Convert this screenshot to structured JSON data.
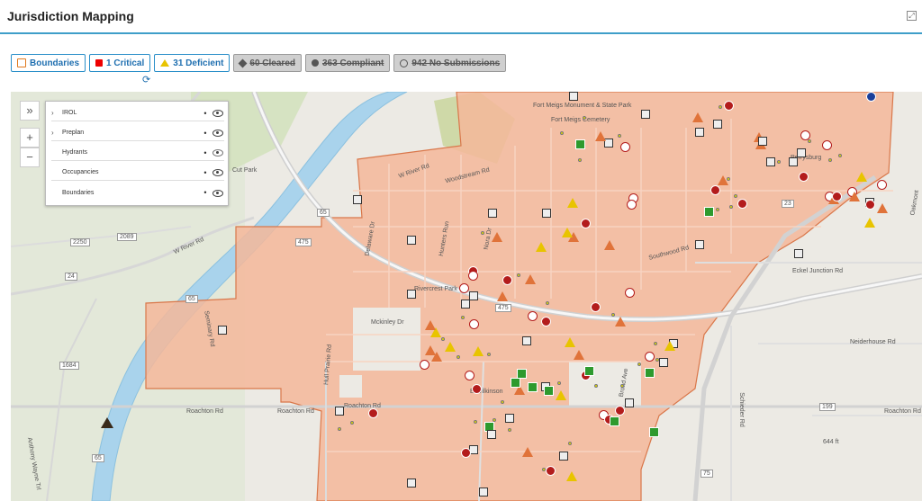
{
  "header": {
    "title": "Jurisdiction Mapping"
  },
  "filters": [
    {
      "label": "Boundaries",
      "icon": "boundary-icon",
      "active": true
    },
    {
      "label": "1 Critical",
      "icon": "critical-square-icon",
      "active": true
    },
    {
      "label": "31 Deficient",
      "icon": "deficient-triangle-icon",
      "active": true
    },
    {
      "label": "60 Cleared",
      "icon": "cleared-diamond-icon",
      "active": false
    },
    {
      "label": "363 Compliant",
      "icon": "compliant-circle-icon",
      "active": false
    },
    {
      "label": "942 No Submissions",
      "icon": "no-submissions-icon",
      "active": false
    }
  ],
  "refresh": {
    "icon": "refresh-icon",
    "glyph": "⟳"
  },
  "map_controls": {
    "collapse": "»",
    "zoom_in": "+",
    "zoom_out": "−"
  },
  "layers": [
    {
      "name": "IROL",
      "expandable": true,
      "visible": true
    },
    {
      "name": "Preplan",
      "expandable": true,
      "visible": true
    },
    {
      "name": "Hydrants",
      "expandable": false,
      "visible": false
    },
    {
      "name": "Occupancies",
      "expandable": false,
      "visible": true
    },
    {
      "name": "Boundaries",
      "expandable": false,
      "visible": true
    }
  ],
  "map_labels": {
    "fort_meigs_monument": "Fort Meigs Monument & State Park",
    "fort_meigs_cemetery": "Fort Meigs Cemetery",
    "cut_park": "Cut Park",
    "w_river_rd_1": "W River Rd",
    "w_river_rd_2": "W River Rd",
    "woodstream_rd": "Woodstream Rd",
    "hunters_run": "Hunters Run",
    "nora_dr": "Nora Dr",
    "delaware_dr": "Delaware Dr",
    "rivercrest_park": "Rivercrest Park",
    "mckinley_dr": "Mckinley Dr",
    "seminary_rd": "Seminary Rd",
    "roachton_rd_1": "Roachton Rd",
    "roachton_rd_2": "Roachton Rd",
    "roachton_rd_3": "Roachton Rd",
    "roachton_rd_4": "Roachton Rd",
    "hull_prairie_rd": "Hull Prairie Rd",
    "anthony_wayne_trl": "Anthony Wayne Trl",
    "e_wilkinson": "E Wilkinson",
    "broad_ave": "Broad Ave",
    "perrysburg": "Perrysburg",
    "eckel_junction_rd": "Eckel Junction Rd",
    "southwood_rd": "Southwood Rd",
    "neiderhouse_rd": "Neiderhouse Rd",
    "schieder_rd": "Schieder Rd",
    "oakmont": "Oakmont",
    "elevation": "644 ft",
    "route_2250": "2250",
    "route_2089": "2089",
    "route_24": "24",
    "route_1684": "1684",
    "route_65a": "65",
    "route_65b": "65",
    "route_65c": "65",
    "route_475a": "475",
    "route_475b": "475",
    "route_23": "23",
    "route_199": "199",
    "route_75": "75"
  },
  "colors": {
    "boundary_fill": "#f4b79a",
    "boundary_stroke": "#d9774a",
    "river": "#a9d3ec",
    "accent": "#2a8fc9",
    "critical": "#e00000",
    "deficient": "#e8c400",
    "marker_red": "#b31c1c",
    "marker_green": "#2e9a2e",
    "marker_orange": "#e0733a"
  }
}
